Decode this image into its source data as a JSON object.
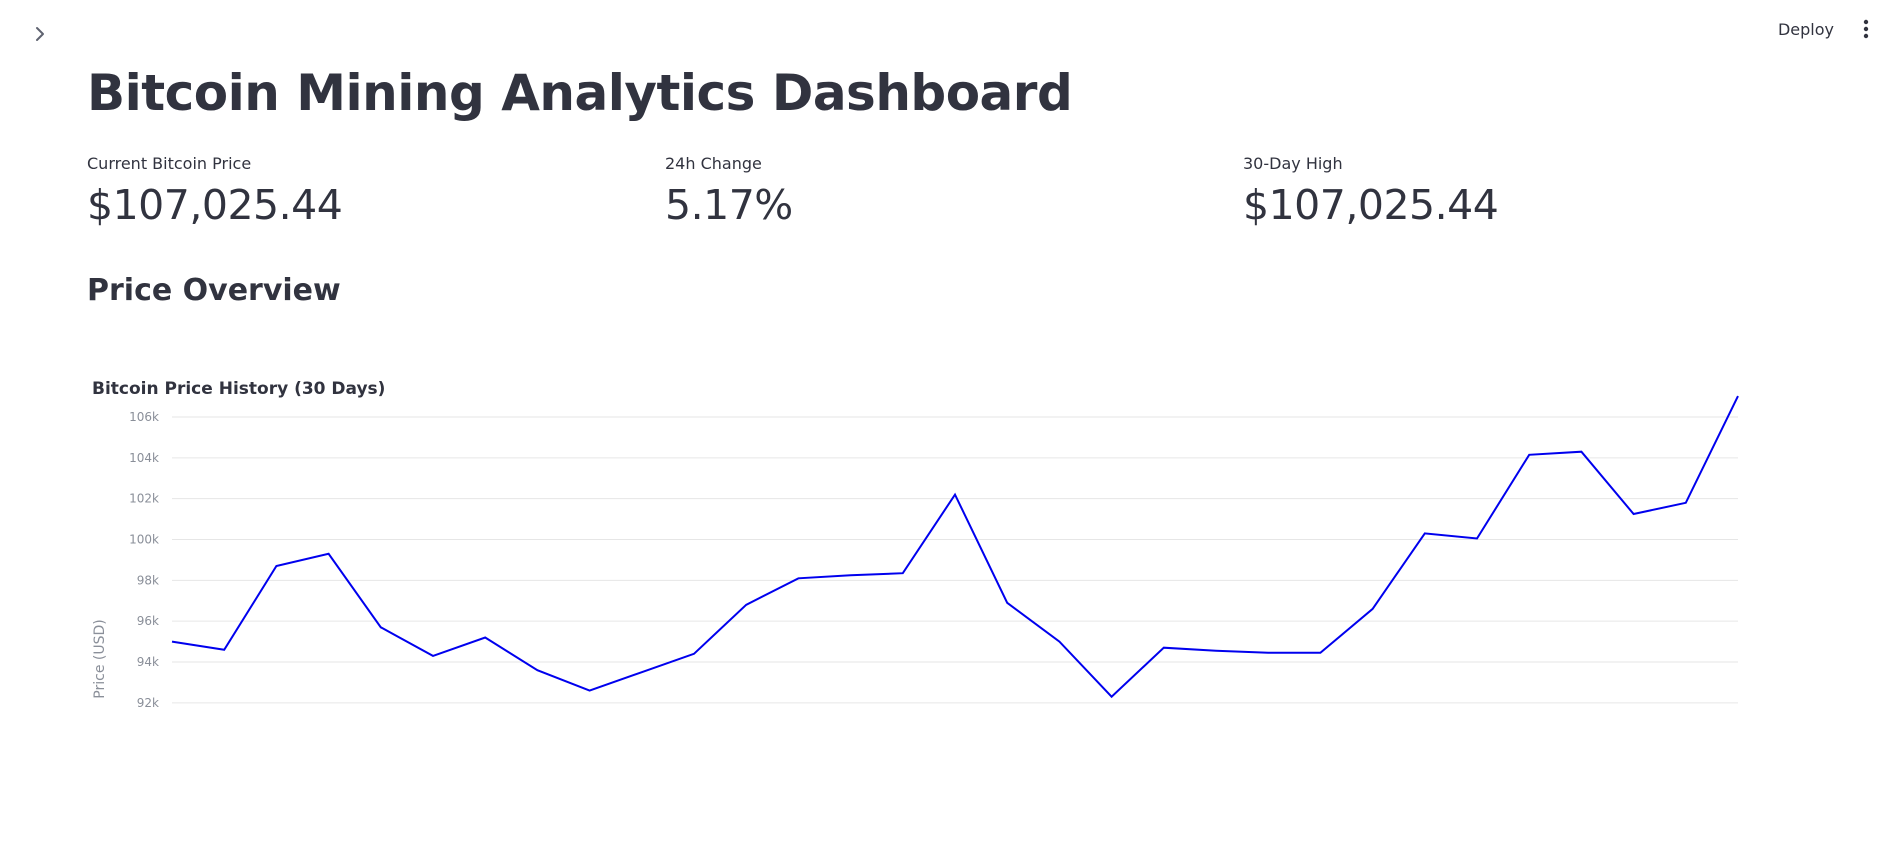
{
  "header": {
    "deploy_label": "Deploy",
    "sidebar_icon": "chevron-right-icon",
    "menu_icon": "vertical-dots-icon"
  },
  "page": {
    "title": "Bitcoin Mining Analytics Dashboard"
  },
  "metrics": [
    {
      "label": "Current Bitcoin Price",
      "value": "$107,025.44"
    },
    {
      "label": "24h Change",
      "value": "5.17%"
    },
    {
      "label": "30-Day High",
      "value": "$107,025.44"
    }
  ],
  "section": {
    "title": "Price Overview"
  },
  "colors": {
    "text": "#31333f",
    "line": "#0000ee",
    "grid": "#e6e6e6",
    "tick": "#8a8f99"
  },
  "chart_data": {
    "type": "line",
    "title": "Bitcoin Price History (30 Days)",
    "xlabel": "",
    "ylabel": "Price (USD)",
    "ylim": [
      92300,
      107500
    ],
    "yticks": [
      {
        "value": 92000,
        "label": "92k"
      },
      {
        "value": 94000,
        "label": "94k"
      },
      {
        "value": 96000,
        "label": "96k"
      },
      {
        "value": 98000,
        "label": "98k"
      },
      {
        "value": 100000,
        "label": "100k"
      },
      {
        "value": 102000,
        "label": "102k"
      },
      {
        "value": 104000,
        "label": "104k"
      },
      {
        "value": 106000,
        "label": "106k"
      }
    ],
    "grid": true,
    "series": [
      {
        "values": [
          95000,
          94600,
          98700,
          99300,
          95700,
          94300,
          95200,
          93600,
          92600,
          93500,
          94400,
          96800,
          98100,
          98250,
          98350,
          102200,
          96900,
          95000,
          92300,
          94700,
          94550,
          94450,
          94450,
          96600,
          100300,
          100050,
          104150,
          104300,
          101250,
          101800,
          107025.44
        ]
      }
    ]
  }
}
